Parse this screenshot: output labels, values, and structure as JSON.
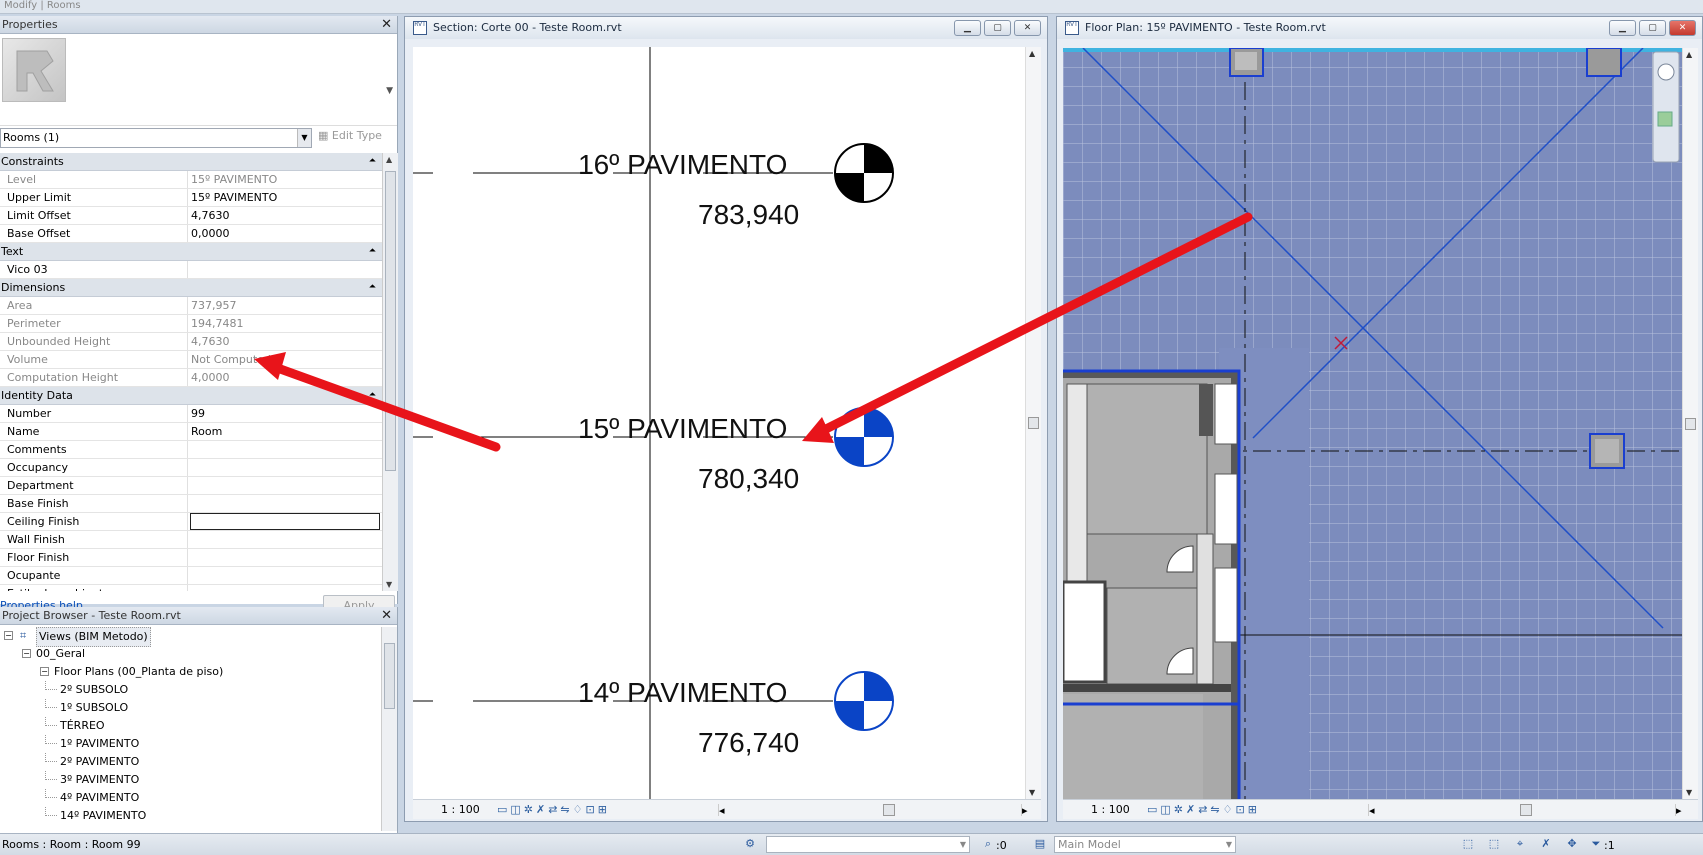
{
  "ribbon_hint": "Modify | Rooms",
  "properties": {
    "title": "Properties",
    "type_selector": "Rooms (1)",
    "edit_type": "Edit Type",
    "groups": [
      {
        "name": "Constraints",
        "rows": [
          {
            "key": "Level",
            "value": "15º PAVIMENTO",
            "readonly": true
          },
          {
            "key": "Upper Limit",
            "value": "15º PAVIMENTO",
            "readonly": false
          },
          {
            "key": "Limit Offset",
            "value": "4,7630",
            "readonly": false
          },
          {
            "key": "Base Offset",
            "value": "0,0000",
            "readonly": false
          }
        ]
      },
      {
        "name": "Text",
        "rows": [
          {
            "key": "Vico 03",
            "value": "",
            "readonly": false
          }
        ]
      },
      {
        "name": "Dimensions",
        "rows": [
          {
            "key": "Area",
            "value": "737,957",
            "readonly": true
          },
          {
            "key": "Perimeter",
            "value": "194,7481",
            "readonly": true
          },
          {
            "key": "Unbounded Height",
            "value": "4,7630",
            "readonly": true
          },
          {
            "key": "Volume",
            "value": "Not Computed",
            "readonly": true
          },
          {
            "key": "Computation Height",
            "value": "4,0000",
            "readonly": true
          }
        ]
      },
      {
        "name": "Identity Data",
        "rows": [
          {
            "key": "Number",
            "value": "99",
            "readonly": false
          },
          {
            "key": "Name",
            "value": "Room",
            "readonly": false
          },
          {
            "key": "Comments",
            "value": "",
            "readonly": false
          },
          {
            "key": "Occupancy",
            "value": "",
            "readonly": false
          },
          {
            "key": "Department",
            "value": "",
            "readonly": false
          },
          {
            "key": "Base Finish",
            "value": "",
            "readonly": false
          },
          {
            "key": "Ceiling Finish",
            "value": "",
            "readonly": false,
            "editing": true
          },
          {
            "key": "Wall Finish",
            "value": "",
            "readonly": false
          },
          {
            "key": "Floor Finish",
            "value": "",
            "readonly": false
          },
          {
            "key": "Ocupante",
            "value": "",
            "readonly": false
          },
          {
            "key": "Estilo de ambiente",
            "value": "",
            "readonly": false
          }
        ]
      }
    ],
    "help_link": "Properties help",
    "apply_button": "Apply"
  },
  "project_browser": {
    "title": "Project Browser - Teste Room.rvt",
    "nodes": [
      {
        "label": "Views (BIM Metodo)",
        "depth": 0,
        "expander": "-",
        "selected": true
      },
      {
        "label": "00_Geral",
        "depth": 1,
        "expander": "-"
      },
      {
        "label": "Floor Plans (00_Planta de piso)",
        "depth": 2,
        "expander": "-"
      },
      {
        "label": "2º SUBSOLO",
        "depth": 3,
        "expander": ""
      },
      {
        "label": "1º SUBSOLO",
        "depth": 3,
        "expander": ""
      },
      {
        "label": "TÉRREO",
        "depth": 3,
        "expander": ""
      },
      {
        "label": "1º PAVIMENTO",
        "depth": 3,
        "expander": ""
      },
      {
        "label": "2º PAVIMENTO",
        "depth": 3,
        "expander": ""
      },
      {
        "label": "3º PAVIMENTO",
        "depth": 3,
        "expander": ""
      },
      {
        "label": "4º PAVIMENTO",
        "depth": 3,
        "expander": ""
      },
      {
        "label": "14º PAVIMENTO",
        "depth": 3,
        "expander": ""
      }
    ]
  },
  "section_view": {
    "title": "Section: Corte 00 - Teste Room.rvt",
    "scale": "1 : 100",
    "levels": [
      {
        "name": "16º PAVIMENTO",
        "elevation": "783,940",
        "marker": "black"
      },
      {
        "name": "15º PAVIMENTO",
        "elevation": "780,340",
        "marker": "blue"
      },
      {
        "name": "14º PAVIMENTO",
        "elevation": "776,740",
        "marker": "blue"
      }
    ]
  },
  "plan_view": {
    "title": "Floor Plan: 15º PAVIMENTO - Teste Room.rvt",
    "scale": "1 : 100"
  },
  "status_bar": {
    "message": "Rooms : Room : Room 99",
    "workset_count": ":0",
    "model_selector": "Main Model",
    "filter_count": ":1"
  },
  "colors": {
    "accent": "#2a5a9e",
    "room_fill": "#7f8fbf",
    "arrow": "#e8141a",
    "level_marker_blue": "#0a44c6"
  }
}
